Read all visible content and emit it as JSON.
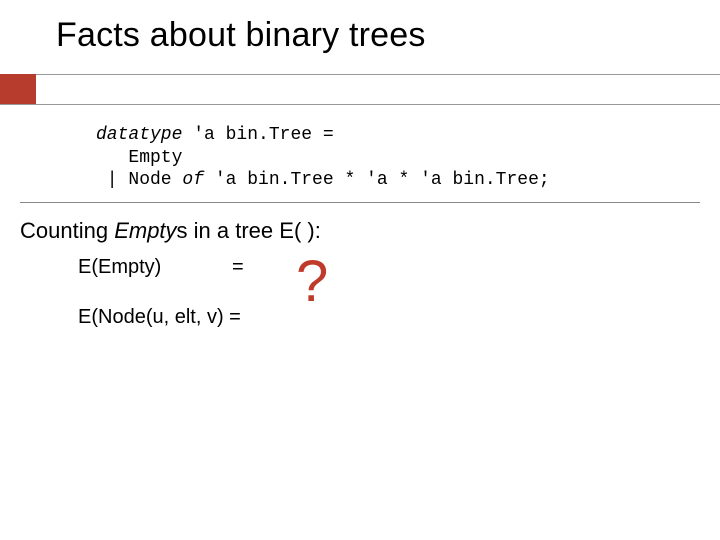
{
  "title": "Facts about binary trees",
  "code": {
    "kw_datatype": "datatype",
    "line1_rest": " 'a bin.Tree =",
    "line2": "   Empty",
    "line3_pipe": " | Node ",
    "kw_of": "of",
    "line3_rest": " 'a bin.Tree * 'a * 'a bin.Tree;"
  },
  "counting": {
    "prefix": "Counting ",
    "empty_word": "Empty",
    "suffix_s": "s",
    "rest": " in a tree E( ):"
  },
  "eq": {
    "line1_lhs": "E(Empty)",
    "line1_eq": "=",
    "line2": "E(Node(u, elt, v) =",
    "qmark": "?"
  }
}
